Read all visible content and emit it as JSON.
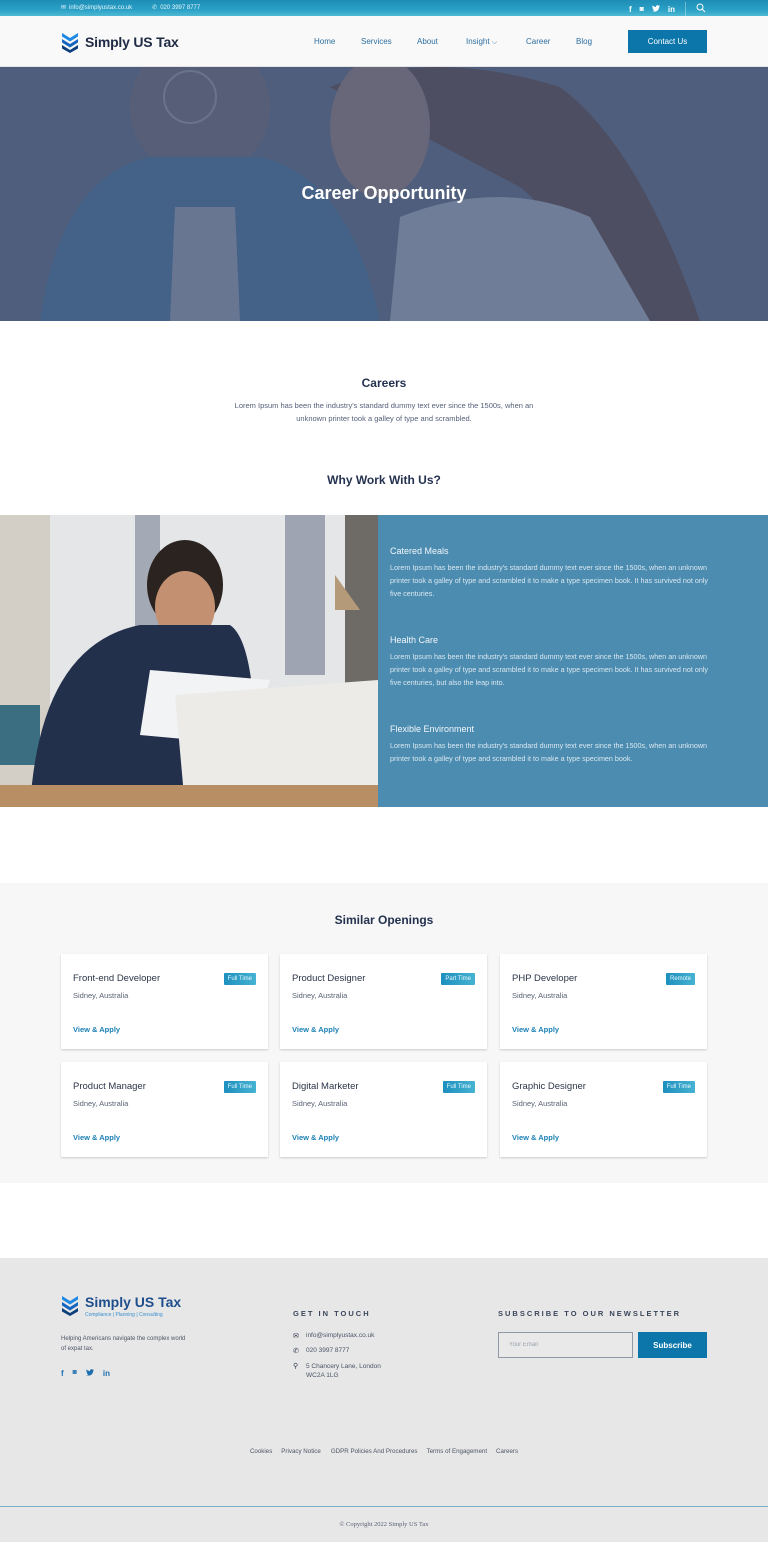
{
  "topbar": {
    "email": "info@simplyustax.co.uk",
    "phone": "020 3997 8777",
    "social": [
      {
        "icon": "facebook-icon",
        "glyph": "f"
      },
      {
        "icon": "instagram-icon",
        "glyph": "◙"
      },
      {
        "icon": "twitter-icon",
        "glyph": "🐦"
      },
      {
        "icon": "linkedin-icon",
        "glyph": "in"
      }
    ],
    "search_icon": "⌕"
  },
  "header": {
    "logo_text": "Simply US Tax",
    "nav": [
      "Home",
      "Services",
      "About",
      "Insight",
      "Career",
      "Blog"
    ],
    "insight_chevron": "⌵",
    "contact_button": "Contact Us"
  },
  "hero": {
    "title": "Career Opportunity"
  },
  "careers": {
    "title": "Careers",
    "text": "Lorem Ipsum has been the industry's standard dummy text ever since the 1500s, when an unknown printer took a galley of type and scrambled."
  },
  "why": {
    "title": "Why Work With Us?",
    "benefits": [
      {
        "title": "Catered Meals",
        "text": "Lorem Ipsum has been the industry's standard dummy text ever since the 1500s, when an unknown printer took a galley of type and scrambled it to make a type specimen book. It has survived not only five centuries."
      },
      {
        "title": "Health Care",
        "text": "Lorem Ipsum has been the industry's standard dummy text ever since the 1500s, when an unknown printer took a galley of type and scrambled it to make a type specimen book. It has survived not only five centuries, but also the leap into."
      },
      {
        "title": "Flexible Environment",
        "text": "Lorem Ipsum has been the industry's standard dummy text ever since the 1500s, when an unknown printer took a galley of type and scrambled it to make a type specimen book."
      }
    ]
  },
  "openings": {
    "title": "Similar Openings",
    "jobs": [
      {
        "title": "Front-end Developer",
        "location": "Sidney, Australia",
        "badge": "Full Time",
        "link": "View & Apply"
      },
      {
        "title": "Product Designer",
        "location": "Sidney, Australia",
        "badge": "Part Time",
        "link": "View & Apply"
      },
      {
        "title": "PHP Developer",
        "location": "Sidney, Australia",
        "badge": "Remote",
        "link": "View & Apply"
      },
      {
        "title": "Product Manager",
        "location": "Sidney, Australia",
        "badge": "Full Time",
        "link": "View & Apply"
      },
      {
        "title": "Digital Marketer",
        "location": "Sidney, Australia",
        "badge": "Full Time",
        "link": "View & Apply"
      },
      {
        "title": "Graphic Designer",
        "location": "Sidney, Australia",
        "badge": "Full Time",
        "link": "View & Apply"
      }
    ]
  },
  "footer": {
    "logo_text": "Simply US Tax",
    "tagline": "Compliance | Planning | Consulting",
    "description": "Helping Americans navigate the complex world of expat tax.",
    "social": [
      "f",
      "◙",
      "🐦",
      "in"
    ],
    "get_in_touch": {
      "heading": "GET IN TOUCH",
      "email": "info@simplyustax.co.uk",
      "phone": "020 3997 8777",
      "address": "5 Chancery Lane, London WC2A 1LG"
    },
    "newsletter": {
      "heading": "SUBSCRIBE TO OUR NEWSLETTER",
      "placeholder": "Your Email",
      "button": "Subscribe"
    },
    "links": [
      "Cookies",
      "Privacy Notice",
      "GDPR Policies And Procedures",
      "Terms of Engagement",
      "Careers"
    ],
    "copyright": "© Copyright 2022 Simply US Tax"
  },
  "colors": {
    "brand_blue": "#0c76ab",
    "panel_blue": "#4b8cb0",
    "link_blue": "#1b80b5",
    "heading_navy": "#243250"
  }
}
